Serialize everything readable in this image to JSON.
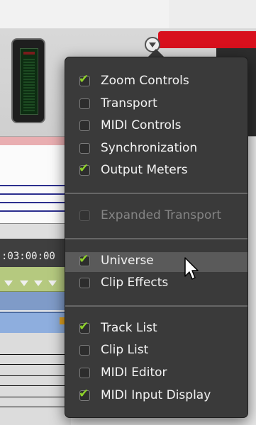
{
  "timeline": {
    "timecode": ":03:00:00"
  },
  "menu": {
    "groups": [
      [
        {
          "label": "Zoom Controls",
          "checked": true,
          "enabled": true
        },
        {
          "label": "Transport",
          "checked": false,
          "enabled": true
        },
        {
          "label": "MIDI Controls",
          "checked": false,
          "enabled": true
        },
        {
          "label": "Synchronization",
          "checked": false,
          "enabled": true
        },
        {
          "label": "Output Meters",
          "checked": true,
          "enabled": true
        }
      ],
      [
        {
          "label": "Expanded Transport",
          "checked": false,
          "enabled": false
        }
      ],
      [
        {
          "label": "Universe",
          "checked": true,
          "enabled": true,
          "highlighted": true
        },
        {
          "label": "Clip Effects",
          "checked": false,
          "enabled": true
        }
      ],
      [
        {
          "label": "Track List",
          "checked": true,
          "enabled": true
        },
        {
          "label": "Clip List",
          "checked": false,
          "enabled": true
        },
        {
          "label": "MIDI Editor",
          "checked": false,
          "enabled": true
        },
        {
          "label": "MIDI Input Display",
          "checked": true,
          "enabled": true
        }
      ]
    ]
  },
  "colors": {
    "accent_check": "#8ed12a",
    "menu_bg": "#3a3a3a",
    "highlight": "#5a5a5a"
  },
  "icons": {
    "checkmark": "check-icon",
    "cursor": "pointer-cursor-icon",
    "menu_button": "chevron-down-circle-icon"
  }
}
